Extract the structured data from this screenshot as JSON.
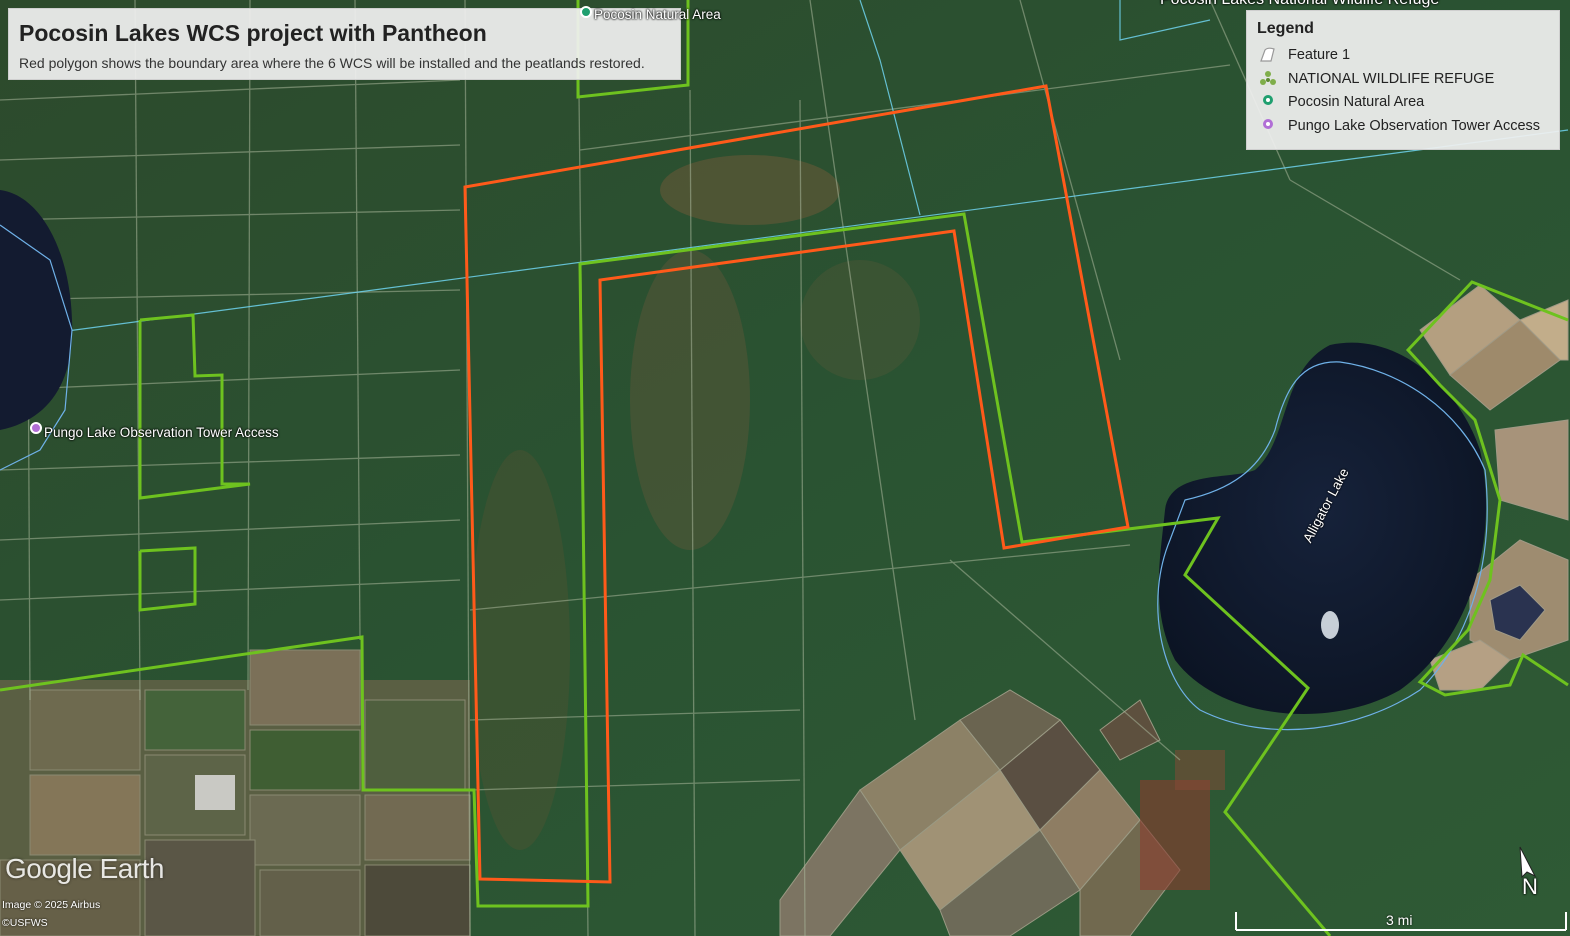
{
  "header": {
    "title": "Pocosin Lakes WCS project with Pantheon",
    "subtitle": "Red polygon shows the boundary area where the 6 WCS will be installed and the peatlands restored."
  },
  "legend": {
    "title": "Legend",
    "items": [
      {
        "label": "Feature 1",
        "icon": "polygon-outline-icon",
        "color": "#ffffff"
      },
      {
        "label": "NATIONAL WILDLIFE REFUGE",
        "icon": "dots-cluster-icon",
        "color": "#7fae4a"
      },
      {
        "label": "Pocosin Natural Area",
        "icon": "place-marker-icon",
        "color": "#1f9f6f"
      },
      {
        "label": "Pungo Lake Observation Tower Access",
        "icon": "place-marker-icon",
        "color": "#b16fd6"
      }
    ]
  },
  "map_labels": {
    "pocosin_natural_area": "Pocosin Natural Area",
    "refuge_top": "Pocosin Lakes National Wildlife Refuge",
    "pungo_tower": "Pungo Lake Observation Tower Access",
    "alligator_lake": "Alligator Lake"
  },
  "colors": {
    "project_boundary": "#ff5a1a",
    "refuge_boundary": "#6ec21f",
    "water_line": "#6fd3ee",
    "lake_water": "#101a2e",
    "pungo_marker": "#b16fd6",
    "pocosin_marker": "#1f9f6f"
  },
  "branding": {
    "watermark": "Google Earth",
    "image_credit": "Image © 2025 Airbus",
    "data_credit": "©USFWS"
  },
  "scale_bar": {
    "label": "3 mi"
  },
  "compass": {
    "label": "N"
  }
}
